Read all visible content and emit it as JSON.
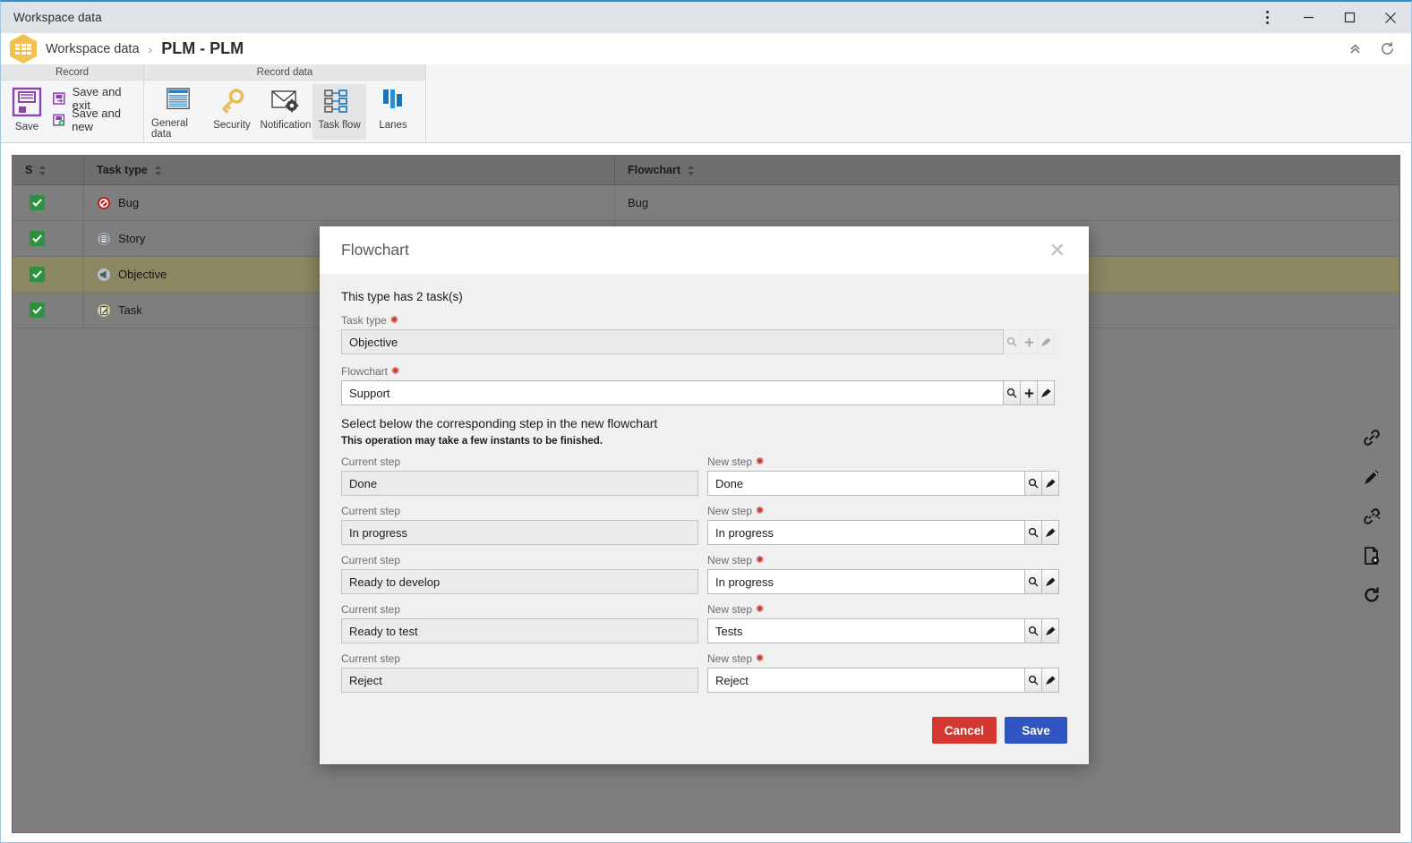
{
  "window": {
    "title": "Workspace data",
    "controls": [
      {
        "name": "menu-kebab",
        "glyph": "kebab"
      },
      {
        "name": "minimize",
        "glyph": "minimize"
      },
      {
        "name": "maximize",
        "glyph": "maximize"
      },
      {
        "name": "close",
        "glyph": "close"
      }
    ]
  },
  "header": {
    "logo_icon": "workspace-grid-icon",
    "breadcrumb_root": "Workspace data",
    "breadcrumb_separator": "›",
    "page_title": "PLM - PLM",
    "collapse_icon": "chevron-double-up-icon",
    "refresh_icon": "refresh-icon"
  },
  "ribbon": {
    "groups": [
      {
        "caption": "Record",
        "big_button": {
          "label": "Save",
          "icon": "floppy-save-icon"
        },
        "small_buttons": [
          {
            "label": "Save and exit",
            "icon": "save-exit-icon"
          },
          {
            "label": "Save and new",
            "icon": "save-new-icon"
          }
        ]
      },
      {
        "caption": "Record data",
        "buttons": [
          {
            "label": "General data",
            "icon": "document-lines-icon",
            "active": false
          },
          {
            "label": "Security",
            "icon": "key-icon",
            "active": false
          },
          {
            "label": "Notification",
            "icon": "envelope-gear-icon",
            "active": false
          },
          {
            "label": "Task flow",
            "icon": "task-flow-icon",
            "active": true
          },
          {
            "label": "Lanes",
            "icon": "lanes-icon",
            "active": false
          }
        ]
      }
    ]
  },
  "grid": {
    "columns": [
      {
        "label": "S",
        "sortable": true
      },
      {
        "label": "Task type",
        "sortable": true
      },
      {
        "label": "Flowchart",
        "sortable": true
      }
    ],
    "rows": [
      {
        "selected_checkbox": true,
        "task_type": "Bug",
        "type_icon": "bug-icon",
        "flowchart": "Bug",
        "highlighted": false
      },
      {
        "selected_checkbox": true,
        "task_type": "Story",
        "type_icon": "story-document-icon",
        "flowchart": "",
        "highlighted": false
      },
      {
        "selected_checkbox": true,
        "task_type": "Objective",
        "type_icon": "objective-megaphone-icon",
        "flowchart": "",
        "highlighted": true
      },
      {
        "selected_checkbox": true,
        "task_type": "Task",
        "type_icon": "task-clipboard-icon",
        "flowchart": "",
        "highlighted": false
      }
    ]
  },
  "right_toolbar": [
    {
      "name": "link-icon"
    },
    {
      "name": "pencil-edit-icon"
    },
    {
      "name": "unlink-broken-icon"
    },
    {
      "name": "document-gear-icon"
    },
    {
      "name": "refresh-circular-icon"
    }
  ],
  "modal": {
    "title": "Flowchart",
    "close_icon": "close-icon",
    "info_text": "This type has 2 task(s)",
    "fields": [
      {
        "label": "Task type",
        "required": true,
        "value": "Objective",
        "readonly": true,
        "buttons": [
          {
            "name": "search-icon",
            "enabled": false
          },
          {
            "name": "plus-icon",
            "enabled": false
          },
          {
            "name": "brush-clear-icon",
            "enabled": false
          }
        ]
      },
      {
        "label": "Flowchart",
        "required": true,
        "value": "Support",
        "readonly": false,
        "buttons": [
          {
            "name": "search-icon",
            "enabled": true
          },
          {
            "name": "plus-icon",
            "enabled": true
          },
          {
            "name": "brush-clear-icon",
            "enabled": true
          }
        ]
      }
    ],
    "section_title": "Select below the corresponding step in the new flowchart",
    "section_note": "This operation may take a few instants to be finished.",
    "current_step_label": "Current step",
    "new_step_label": "New step",
    "step_rows": [
      {
        "current": "Done",
        "new": "Done"
      },
      {
        "current": "In progress",
        "new": "In progress"
      },
      {
        "current": "Ready to develop",
        "new": "In progress"
      },
      {
        "current": "Ready to test",
        "new": "Tests"
      },
      {
        "current": "Reject",
        "new": "Reject"
      }
    ],
    "step_buttons": [
      {
        "name": "search-icon"
      },
      {
        "name": "brush-clear-icon"
      }
    ],
    "cancel_label": "Cancel",
    "save_label": "Save"
  },
  "colors": {
    "accent_blue": "#2b8fd4",
    "save_button": "#3155c0",
    "cancel_button": "#d4372f",
    "grid_bg": "#7e7e7e",
    "grid_header": "#6e6e6e",
    "row_highlight": "#8b8763",
    "checkbox_green": "#2e9141",
    "required_red": "#c0392b"
  }
}
